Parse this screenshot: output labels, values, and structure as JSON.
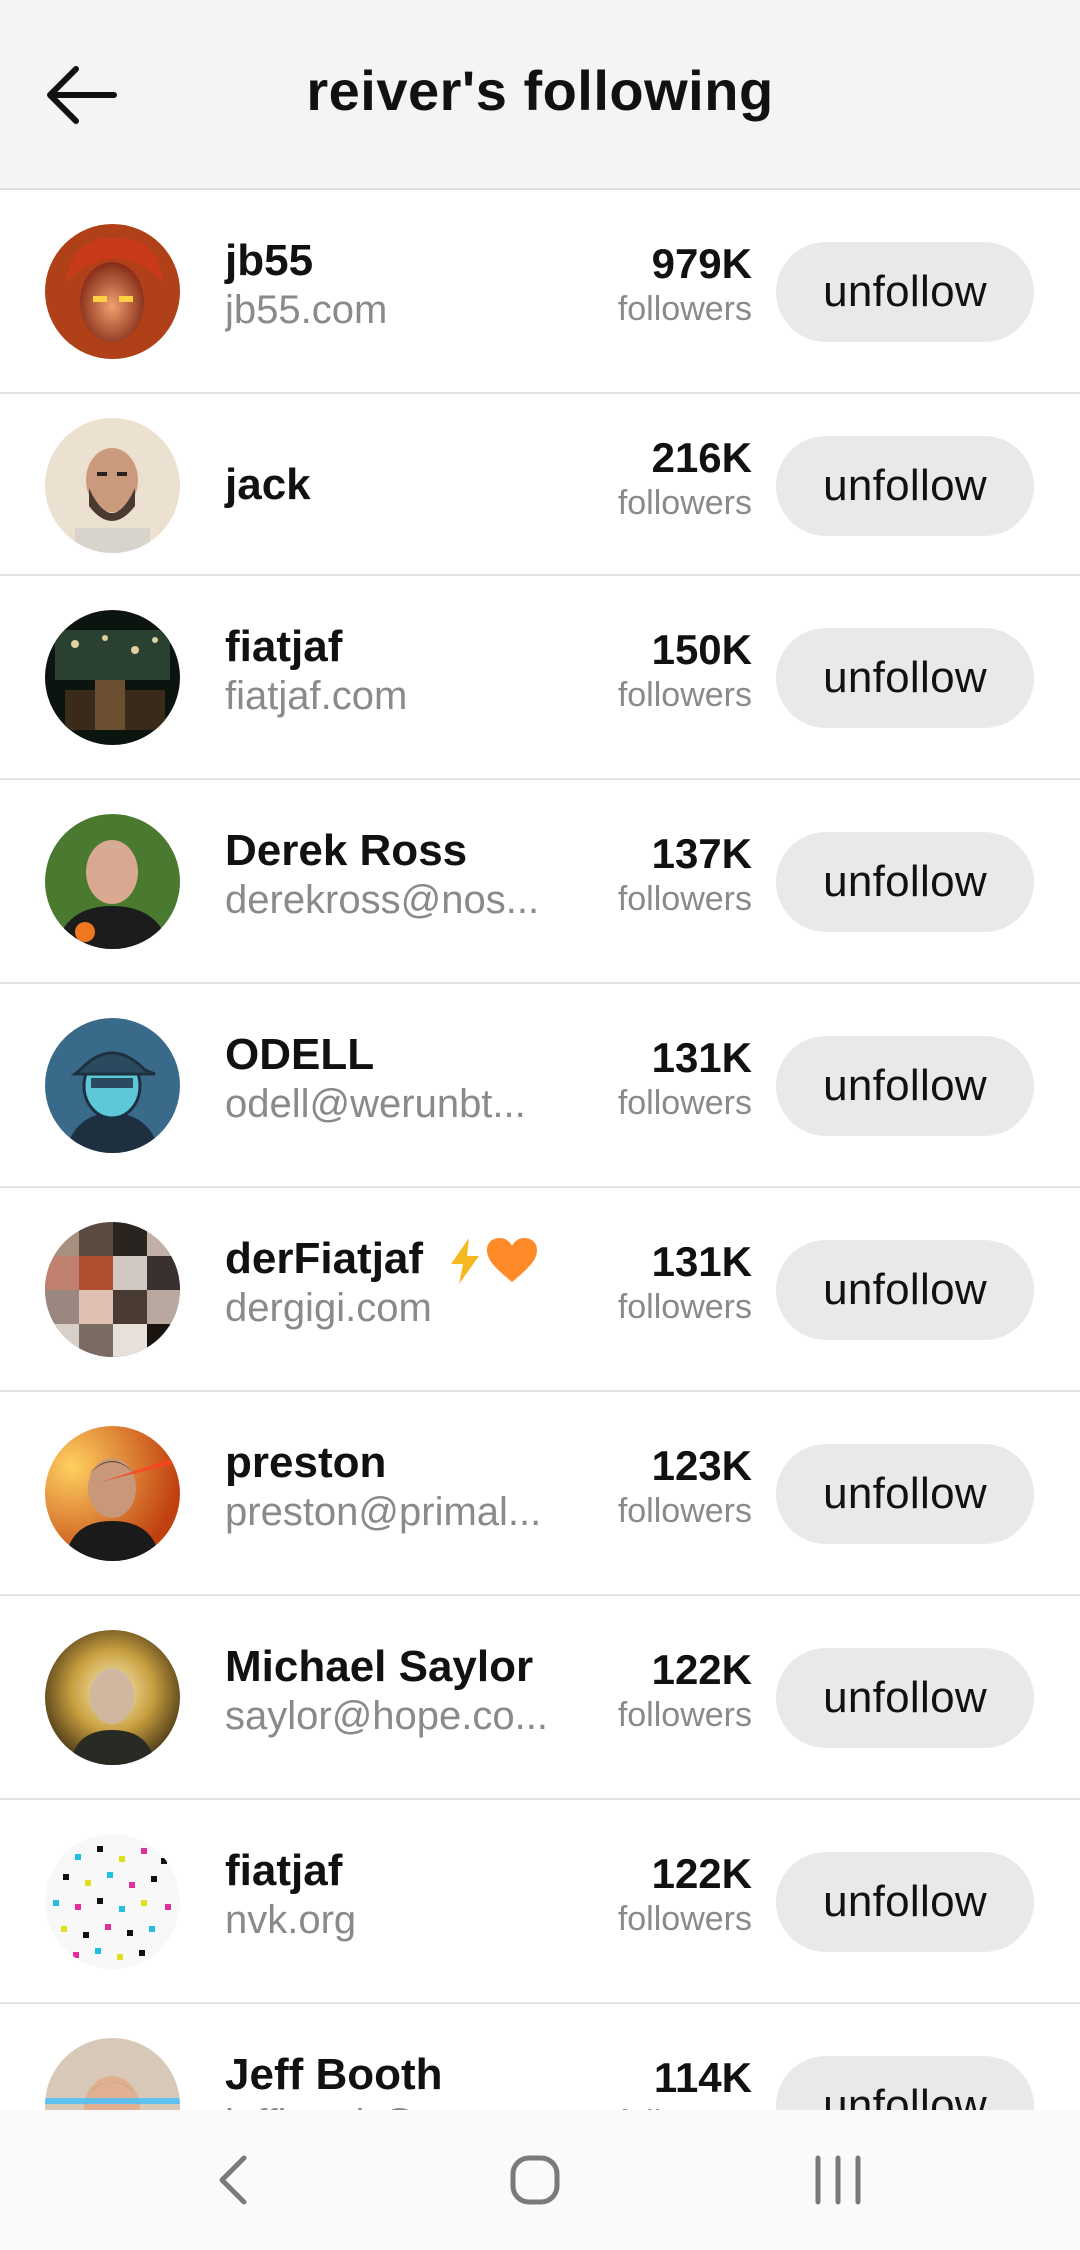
{
  "header": {
    "title": "reiver's following",
    "back_icon": "arrow-left-icon"
  },
  "follow_button_label": "unfollow",
  "followers_label": "followers",
  "users": [
    {
      "name": "jb55",
      "handle": "jb55.com",
      "count": "979K"
    },
    {
      "name": "jack",
      "handle": "",
      "count": "216K"
    },
    {
      "name": "fiatjaf",
      "handle": "fiatjaf.com",
      "count": "150K"
    },
    {
      "name": "Derek Ross",
      "handle": "derekross@nos...",
      "count": "137K"
    },
    {
      "name": "ODELL",
      "handle": "odell@werunbt...",
      "count": "131K"
    },
    {
      "name": "derFiatjaf",
      "handle": "dergigi.com",
      "count": "131K",
      "emojis": [
        "lightning-icon",
        "orange-heart-icon"
      ]
    },
    {
      "name": "preston",
      "handle": "preston@primal...",
      "count": "123K"
    },
    {
      "name": "Michael Saylor",
      "handle": "saylor@hope.co...",
      "count": "122K"
    },
    {
      "name": "fiatjaf",
      "handle": "nvk.org",
      "count": "122K"
    },
    {
      "name": "Jeff Booth",
      "handle": "jeffbooth@nostr...",
      "count": "114K"
    }
  ],
  "system_nav": {
    "back": "nav-back-icon",
    "home": "nav-home-icon",
    "recents": "nav-recents-icon"
  }
}
